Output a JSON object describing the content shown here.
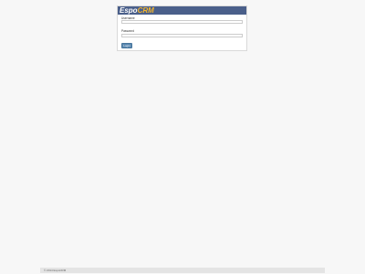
{
  "brand": {
    "logo_part1": "Espo",
    "logo_part2": "CRM",
    "header_color": "#4a5f8a",
    "accent_color": "#f2b52e"
  },
  "login": {
    "username_label": "Username",
    "username_value": "",
    "password_label": "Password",
    "password_value": "",
    "button_label": "Login",
    "button_color": "#5a88b0"
  },
  "footer": {
    "text": "© 2014 EspoCRM"
  }
}
